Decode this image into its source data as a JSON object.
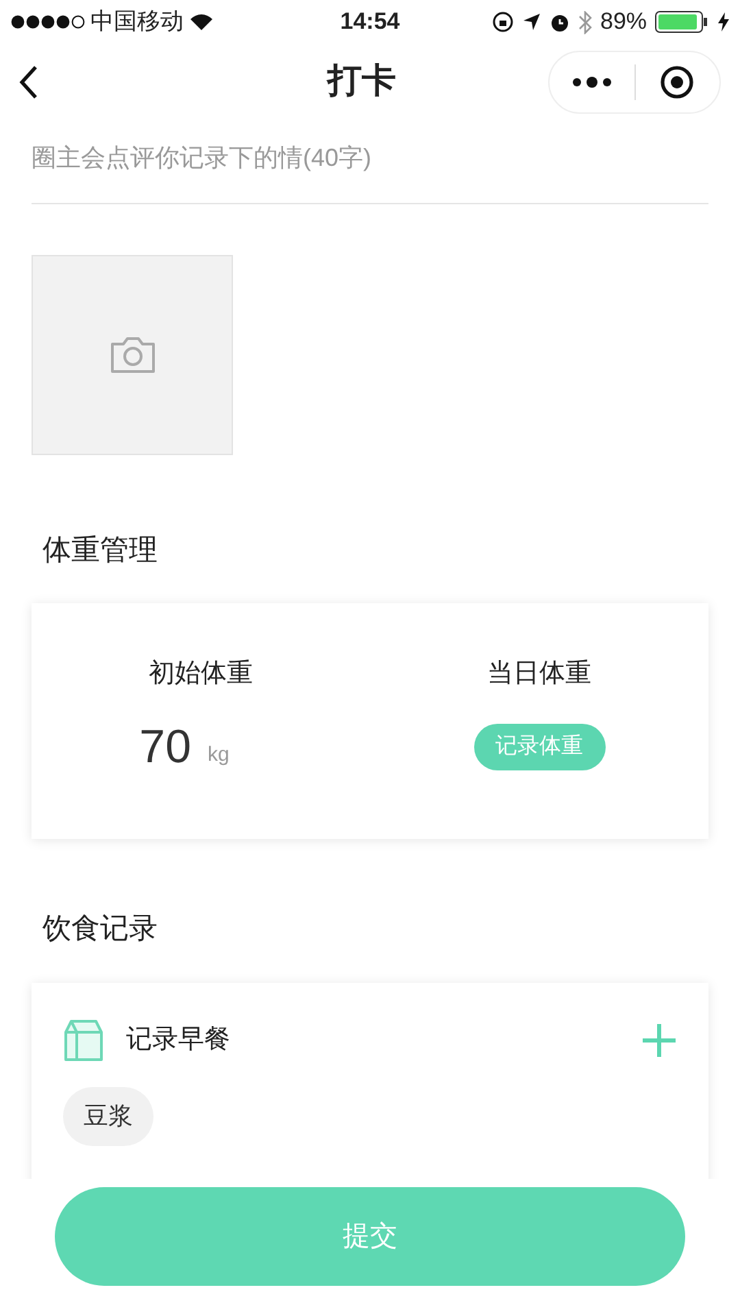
{
  "status_bar": {
    "carrier": "中国移动",
    "time": "14:54",
    "battery": "89%"
  },
  "nav": {
    "title": "打卡"
  },
  "comment": {
    "placeholder": "圈主会点评你记录下的情(40字)"
  },
  "weight": {
    "title": "体重管理",
    "initial_label": "初始体重",
    "initial_value": "70",
    "unit": "kg",
    "today_label": "当日体重",
    "record_button": "记录体重"
  },
  "diet": {
    "title": "饮食记录",
    "meals": [
      {
        "title": "记录早餐",
        "items": [
          "豆浆"
        ]
      }
    ]
  },
  "submit": "提交"
}
